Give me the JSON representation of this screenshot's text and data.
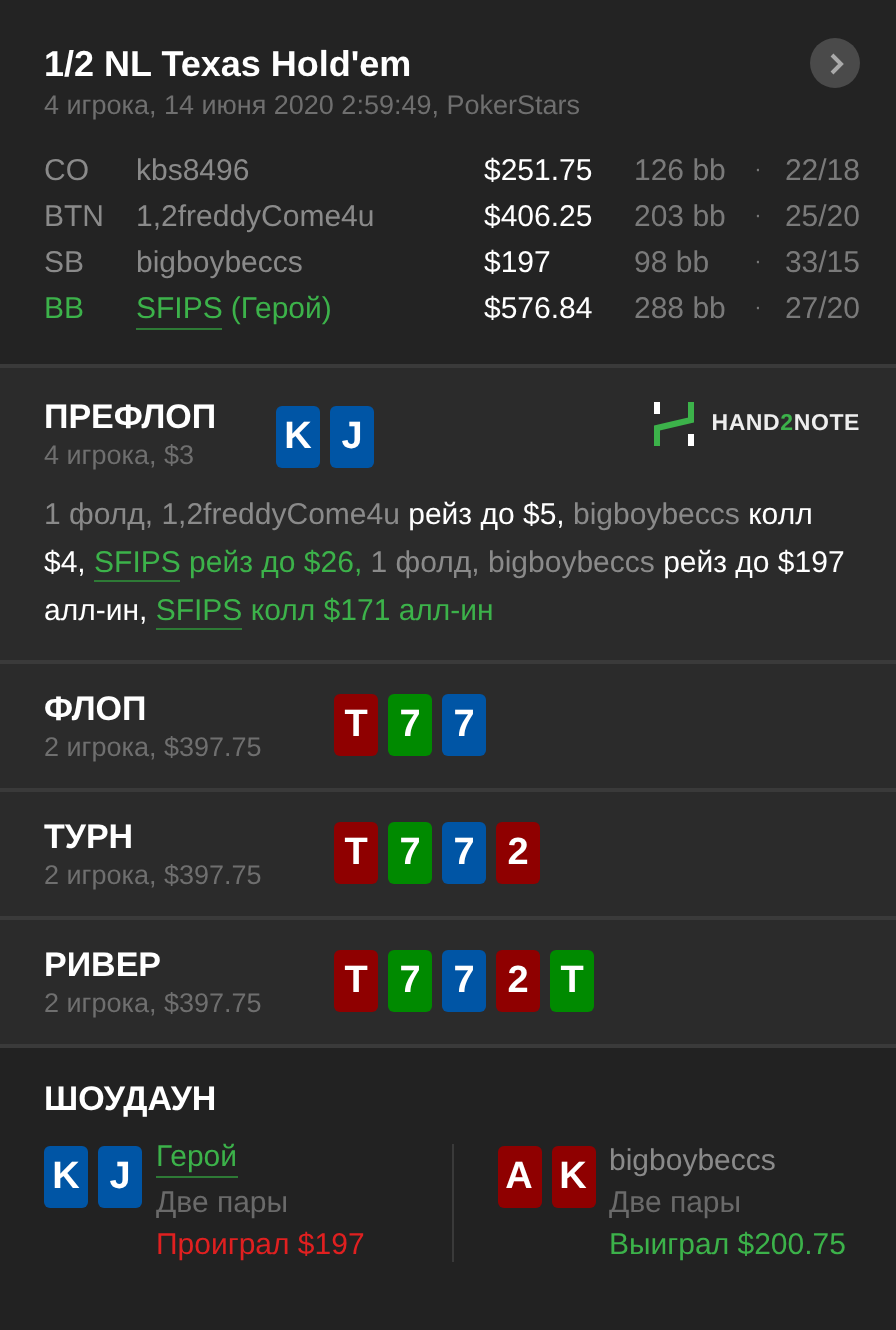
{
  "header": {
    "title": "1/2 NL Texas Hold'em",
    "subtitle": "4 игрока, 14 июня 2020 2:59:49, PokerStars",
    "players": [
      {
        "position": "CO",
        "name": "kbs8496",
        "hero": false,
        "stack": "$251.75",
        "bb": "126 bb",
        "sep": "·",
        "stats": "22/18"
      },
      {
        "position": "BTN",
        "name": "1,2freddyCome4u",
        "hero": false,
        "stack": "$406.25",
        "bb": "203 bb",
        "sep": "·",
        "stats": "25/20"
      },
      {
        "position": "SB",
        "name": "bigboybeccs",
        "hero": false,
        "stack": "$197",
        "bb": "98 bb",
        "sep": "·",
        "stats": "33/15"
      },
      {
        "position": "BB",
        "name": "SFIPS",
        "tag": "(Герой)",
        "hero": true,
        "stack": "$576.84",
        "bb": "288 bb",
        "sep": "·",
        "stats": "27/20"
      }
    ]
  },
  "preflop": {
    "title": "ПРЕФЛОП",
    "info": "4 игрока, $3",
    "cards": [
      {
        "rank": "K",
        "color": "#0055a5"
      },
      {
        "rank": "J",
        "color": "#0055a5"
      }
    ],
    "logo": {
      "before": "HAND",
      "accent": "2",
      "after": "NOTE"
    },
    "actions": [
      {
        "kind": "plain",
        "text": "1 фолд, 1,2freddyCome4u "
      },
      {
        "kind": "bet",
        "text": "рейз до $5,"
      },
      {
        "kind": "plain",
        "text": " bigboybeccs "
      },
      {
        "kind": "bet",
        "text": "колл $4, "
      },
      {
        "kind": "hero_link",
        "text": "SFIPS"
      },
      {
        "kind": "hero_bet",
        "text": " рейз до $26,"
      },
      {
        "kind": "plain",
        "text": " 1 фолд, bigboybeccs "
      },
      {
        "kind": "bet",
        "text": "рейз до $197 алл-ин, "
      },
      {
        "kind": "hero_link",
        "text": "SFIPS"
      },
      {
        "kind": "hero_bet",
        "text": " колл $171 алл-ин"
      }
    ]
  },
  "streets": [
    {
      "title": "ФЛОП",
      "info": "2 игрока, $397.75",
      "cards": [
        {
          "rank": "T",
          "color": "#8f0000"
        },
        {
          "rank": "7",
          "color": "#008a00"
        },
        {
          "rank": "7",
          "color": "#0055a5"
        }
      ]
    },
    {
      "title": "ТУРН",
      "info": "2 игрока, $397.75",
      "cards": [
        {
          "rank": "T",
          "color": "#8f0000"
        },
        {
          "rank": "7",
          "color": "#008a00"
        },
        {
          "rank": "7",
          "color": "#0055a5"
        },
        {
          "rank": "2",
          "color": "#8f0000"
        }
      ]
    },
    {
      "title": "РИВЕР",
      "info": "2 игрока, $397.75",
      "cards": [
        {
          "rank": "T",
          "color": "#8f0000"
        },
        {
          "rank": "7",
          "color": "#008a00"
        },
        {
          "rank": "7",
          "color": "#0055a5"
        },
        {
          "rank": "2",
          "color": "#8f0000"
        },
        {
          "rank": "T",
          "color": "#008a00"
        }
      ]
    }
  ],
  "showdown": {
    "title": "ШОУДАУН",
    "hands": [
      {
        "name": "Герой",
        "hero": true,
        "combo": "Две пары",
        "result": "Проиграл $197",
        "won": false,
        "cards": [
          {
            "rank": "K",
            "color": "#0055a5"
          },
          {
            "rank": "J",
            "color": "#0055a5"
          }
        ]
      },
      {
        "name": "bigboybeccs",
        "hero": false,
        "combo": "Две пары",
        "result": "Выиграл $200.75",
        "won": true,
        "cards": [
          {
            "rank": "A",
            "color": "#8f0000"
          },
          {
            "rank": "K",
            "color": "#8f0000"
          }
        ]
      }
    ]
  }
}
